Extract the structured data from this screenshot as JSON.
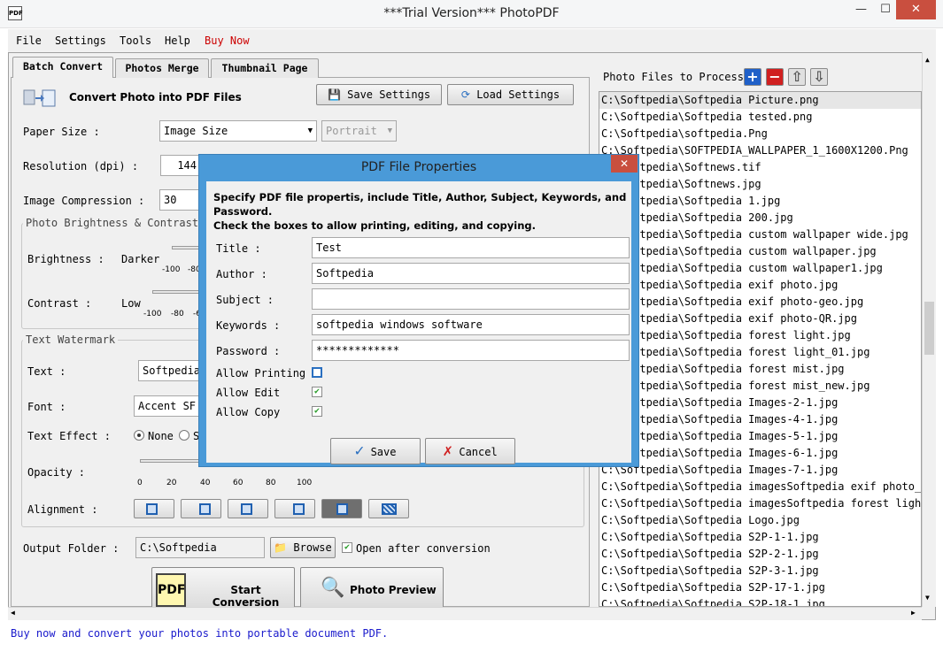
{
  "window": {
    "title": "***Trial Version*** PhotoPDF",
    "app_icon": "PDF",
    "minimize": "—",
    "maximize": "☐",
    "close": "✕"
  },
  "menu": {
    "items": [
      "File",
      "Settings",
      "Tools",
      "Help",
      "Buy Now"
    ],
    "buy_color": "#cc0000"
  },
  "tabs": [
    "Batch Convert",
    "Photos Merge",
    "Thumbnail Page"
  ],
  "batch": {
    "header": "Convert Photo into PDF Files",
    "save_settings": "Save Settings",
    "load_settings": "Load Settings",
    "paper_size_label": "Paper Size :",
    "paper_size_value": "Image Size",
    "orientation_value": "Portrait",
    "resolution_label": "Resolution (dpi) :",
    "resolution_value": "144",
    "compression_label": "Image Compression :",
    "compression_value": "30",
    "brightness_group": "Photo Brightness & Contrast",
    "brightness_label": "Brightness :",
    "brightness_low": "Darker",
    "brightness_ticks": [
      "-100",
      "-80"
    ],
    "contrast_label": "Contrast :",
    "contrast_low": "Low",
    "contrast_ticks": [
      "-100",
      "-80",
      "-6"
    ],
    "watermark_group": "Text Watermark",
    "text_label": "Text :",
    "text_value": "Softpedia",
    "font_label": "Font :",
    "font_value": "Accent SF",
    "effect_label": "Text Effect :",
    "effect_none": "None",
    "effect_s": "S",
    "opacity_label": "Opacity :",
    "opacity_ticks": [
      "0",
      "20",
      "40",
      "60",
      "80",
      "100"
    ],
    "alignment_label": "Alignment :",
    "output_label": "Output Folder :",
    "output_value": "C:\\Softpedia",
    "browse": "Browse",
    "open_after": "Open after conversion",
    "start": "Start Conversion",
    "preview": "Photo Preview"
  },
  "files": {
    "header": "Photo Files to Process",
    "rows": [
      "C:\\Softpedia\\Softpedia Picture.png",
      "C:\\Softpedia\\Softpedia tested.png",
      "C:\\Softpedia\\softpedia.Png",
      "C:\\Softpedia\\SOFTPEDIA_WALLPAPER_1_1600X1200.Png",
      "C:\\Softpedia\\Softnews.tif",
      "C:\\Softpedia\\Softnews.jpg",
      "C:\\Softpedia\\Softpedia 1.jpg",
      "C:\\Softpedia\\Softpedia 200.jpg",
      "C:\\Softpedia\\Softpedia custom wallpaper wide.jpg",
      "C:\\Softpedia\\Softpedia custom wallpaper.jpg",
      "C:\\Softpedia\\Softpedia custom wallpaper1.jpg",
      "C:\\Softpedia\\Softpedia exif photo.jpg",
      "C:\\Softpedia\\Softpedia exif photo-geo.jpg",
      "C:\\Softpedia\\Softpedia exif photo-QR.jpg",
      "C:\\Softpedia\\Softpedia forest light.jpg",
      "C:\\Softpedia\\Softpedia forest light_01.jpg",
      "C:\\Softpedia\\Softpedia forest mist.jpg",
      "C:\\Softpedia\\Softpedia forest mist_new.jpg",
      "C:\\Softpedia\\Softpedia Images-2-1.jpg",
      "C:\\Softpedia\\Softpedia Images-4-1.jpg",
      "C:\\Softpedia\\Softpedia Images-5-1.jpg",
      "C:\\Softpedia\\Softpedia Images-6-1.jpg",
      "C:\\Softpedia\\Softpedia Images-7-1.jpg",
      "C:\\Softpedia\\Softpedia imagesSoftpedia exif photo_Ta",
      "C:\\Softpedia\\Softpedia imagesSoftpedia forest light_",
      "C:\\Softpedia\\Softpedia Logo.jpg",
      "C:\\Softpedia\\Softpedia S2P-1-1.jpg",
      "C:\\Softpedia\\Softpedia S2P-2-1.jpg",
      "C:\\Softpedia\\Softpedia S2P-3-1.jpg",
      "C:\\Softpedia\\Softpedia S2P-17-1.jpg",
      "C:\\Softpedia\\Softpedia S2P-18-1.jpg"
    ]
  },
  "status": "Buy now and convert your photos into portable document PDF.",
  "dialog": {
    "title": "PDF File Properties",
    "intro1": "Specify PDF file propertis, include Title, Author, Subject, Keywords, and Password.",
    "intro2": "Check the boxes to allow printing, editing, and copying.",
    "title_label": "Title :",
    "title_value": "Test",
    "author_label": "Author :",
    "author_value": "Softpedia",
    "subject_label": "Subject :",
    "subject_value": "",
    "keywords_label": "Keywords :",
    "keywords_value": "softpedia windows software",
    "password_label": "Password :",
    "password_value": "*************",
    "allow_printing": "Allow Printing",
    "allow_edit": "Allow Edit",
    "allow_copy": "Allow Copy",
    "save": "Save",
    "cancel": "Cancel",
    "close": "✕"
  }
}
